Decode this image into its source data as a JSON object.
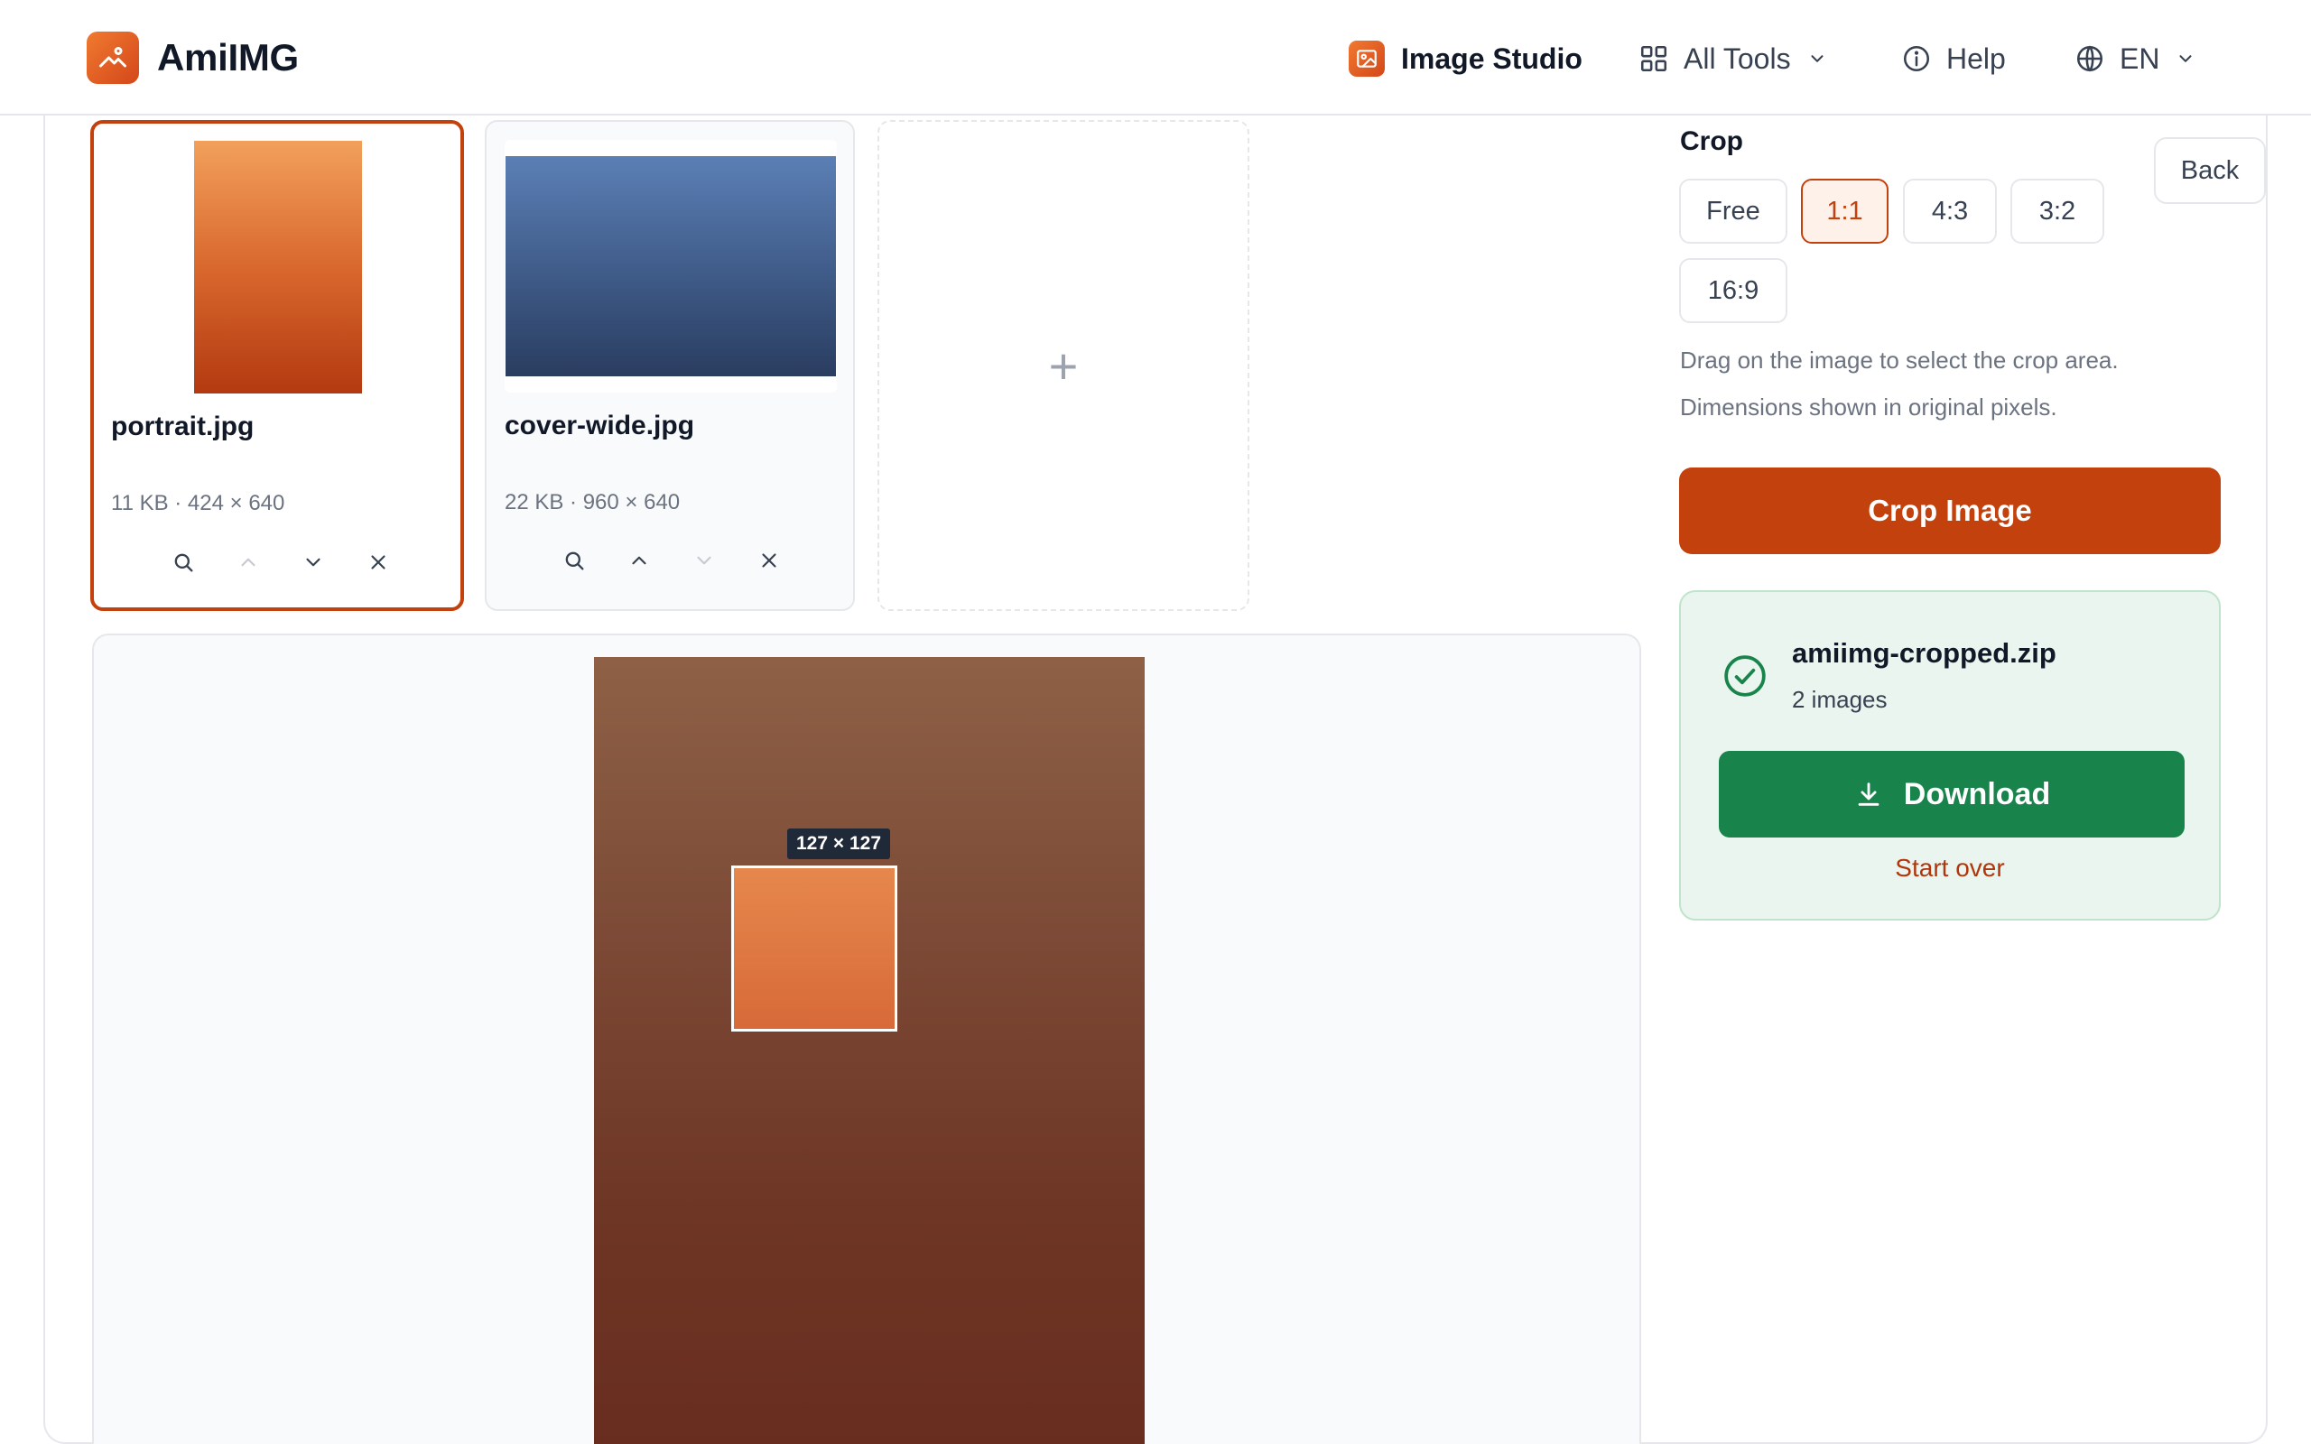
{
  "header": {
    "brand_name": "AmiIMG",
    "nav": {
      "studio": "Image Studio",
      "tools": "All Tools",
      "help": "Help",
      "language": "EN"
    }
  },
  "thumbnails": [
    {
      "name": "portrait.jpg",
      "meta": "11 KB · 424 × 640",
      "selected": true
    },
    {
      "name": "cover-wide.jpg",
      "meta": "22 KB · 960 × 640",
      "selected": false
    }
  ],
  "add_tile": {
    "symbol": "+"
  },
  "editor": {
    "selection_label": "127 × 127"
  },
  "sidebar": {
    "section_title": "Crop",
    "back_label": "Back",
    "ratios": [
      "Free",
      "1:1",
      "4:3",
      "3:2",
      "16:9"
    ],
    "active_ratio": "1:1",
    "hint_1": "Drag on the image to select the crop area.",
    "hint_2": "Dimensions shown in original pixels.",
    "crop_button": "Crop Image"
  },
  "result": {
    "file_name": "amiimg-cropped.zip",
    "count": "2 images",
    "download_label": "Download",
    "start_over_label": "Start over"
  },
  "colors": {
    "accent": "#c2410c",
    "success": "#18834b",
    "success_bg": "#e9f5ee"
  }
}
